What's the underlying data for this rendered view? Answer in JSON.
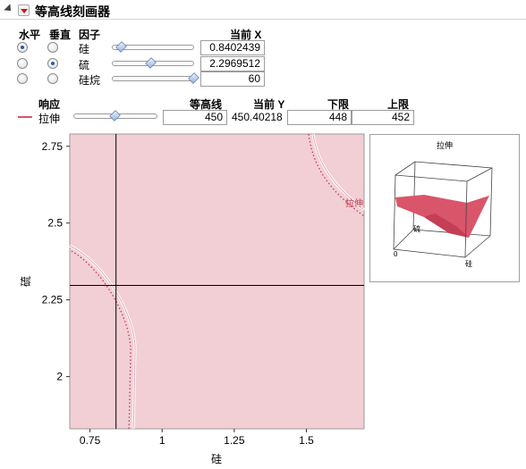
{
  "header": {
    "title": "等高线刻画器"
  },
  "factors": {
    "col_horizontal": "水平",
    "col_vertical": "垂直",
    "col_factor": "因子",
    "col_current_x": "当前 X",
    "rows": [
      {
        "name": "硅",
        "value": "0.8402439",
        "horizontal": true,
        "vertical": false,
        "slider_fraction": 0.12
      },
      {
        "name": "硫",
        "value": "2.2969512",
        "horizontal": false,
        "vertical": true,
        "slider_fraction": 0.48
      },
      {
        "name": "硅烷",
        "value": "60",
        "horizontal": false,
        "vertical": false,
        "slider_fraction": 1.0
      }
    ]
  },
  "responses": {
    "col_response": "响应",
    "col_contour": "等高线",
    "col_current_y": "当前 Y",
    "col_lower": "下限",
    "col_upper": "上限",
    "rows": [
      {
        "name": "拉伸",
        "contour": "450",
        "current_y": "450.40218",
        "lower": "448",
        "upper": "452",
        "color": "#d9556a",
        "slider_fraction": 0.5
      }
    ]
  },
  "contour_plot": {
    "xlabel": "硅",
    "ylabel": "硫",
    "x_ticks": [
      "0.75",
      "1",
      "1.25",
      "1.5"
    ],
    "y_ticks": [
      "2",
      "2.25",
      "2.5",
      "2.75"
    ],
    "xlim": [
      0.68,
      1.7
    ],
    "ylim": [
      1.83,
      2.79
    ],
    "crosshair": {
      "x": 0.8402439,
      "y": 2.2969512
    },
    "contour_label": "拉伸",
    "fill_color": "#f2cfd5"
  },
  "surface_plot": {
    "title": "拉伸",
    "x_axis_label": "硅",
    "y_axis_label": "硫",
    "origin_label": "0",
    "surface_color": "#d9556a"
  }
}
